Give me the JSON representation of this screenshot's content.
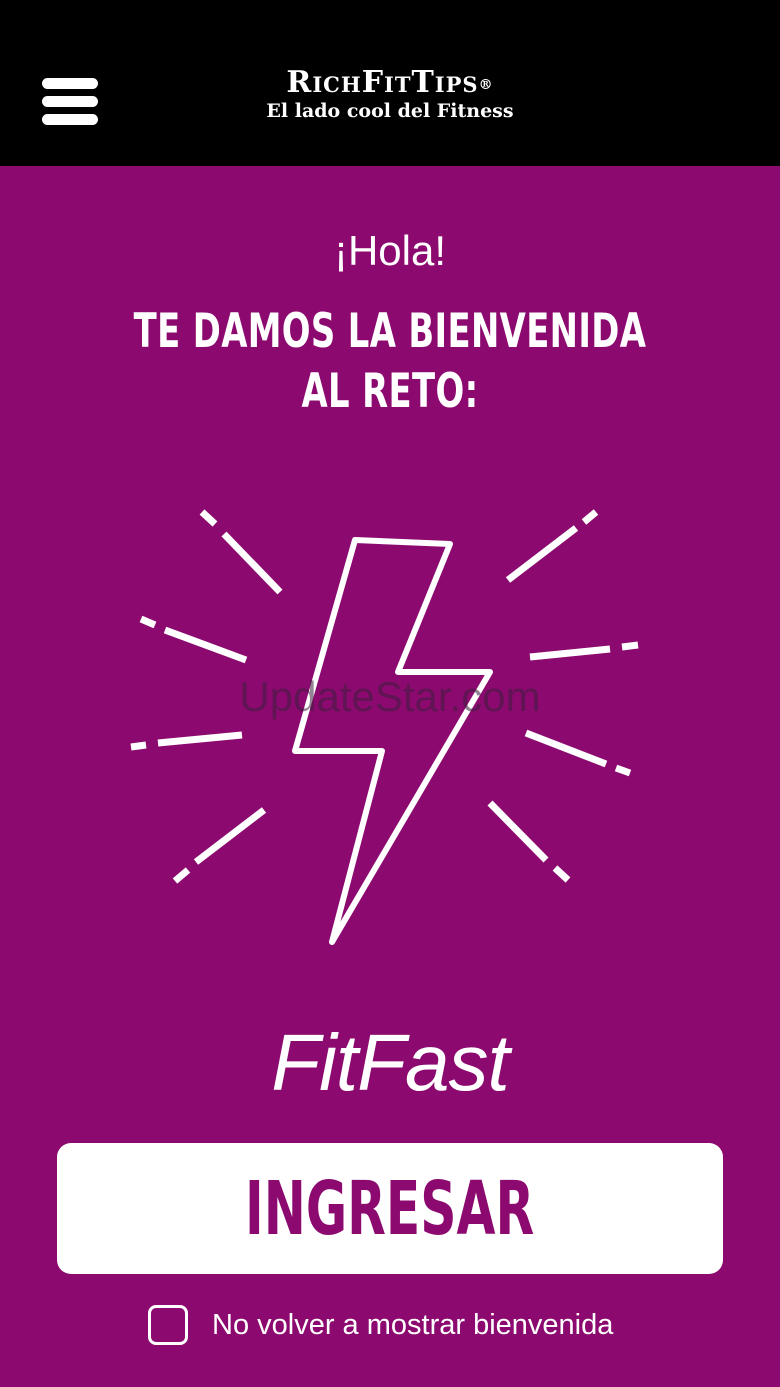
{
  "header": {
    "brand_name": "RichFitTips",
    "brand_mark": "®",
    "tagline": "El lado cool del Fitness",
    "menu_icon": "hamburger-menu-icon"
  },
  "main": {
    "greeting": "¡Hola!",
    "welcome": "TE DAMOS LA BIENVENIDA AL RETO:",
    "hero_icon": "lightning-bolt-icon",
    "watermark": "UpdateStar.com",
    "challenge_name": "FitFast",
    "cta_label": "INGRESAR",
    "dont_show_label": "No volver a mostrar bienvenida",
    "dont_show_checked": false
  },
  "colors": {
    "background": "#8c0a6f",
    "header": "#000000",
    "button": "#ffffff",
    "button_text": "#8c0a6f"
  }
}
